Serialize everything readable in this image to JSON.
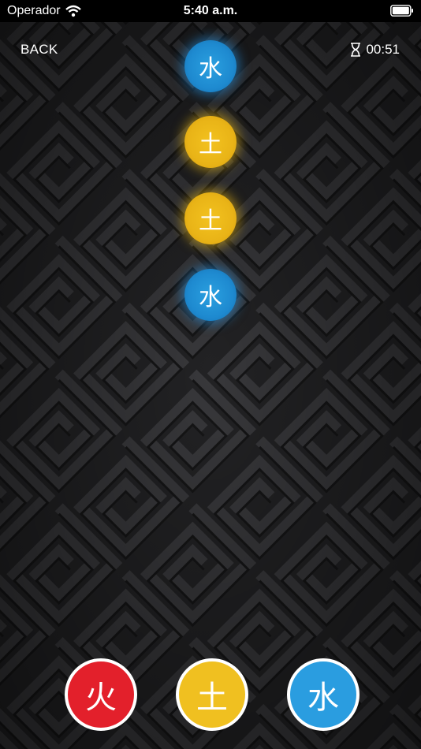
{
  "status": {
    "carrier": "Operador",
    "time": "5:40 a.m."
  },
  "header": {
    "back_label": "BACK",
    "timer_value": "00:51"
  },
  "falling": [
    {
      "glyph": "水",
      "element": "water"
    },
    {
      "glyph": "土",
      "element": "earth"
    },
    {
      "glyph": "土",
      "element": "earth"
    },
    {
      "glyph": "水",
      "element": "water"
    }
  ],
  "controls": [
    {
      "glyph": "火",
      "element": "fire",
      "color": "#e3202b"
    },
    {
      "glyph": "土",
      "element": "earth",
      "color": "#f0c020"
    },
    {
      "glyph": "水",
      "element": "water",
      "color": "#2a9de0"
    }
  ],
  "icons": {
    "wifi": "wifi-icon",
    "battery": "battery-icon",
    "timer": "hourglass-icon"
  }
}
